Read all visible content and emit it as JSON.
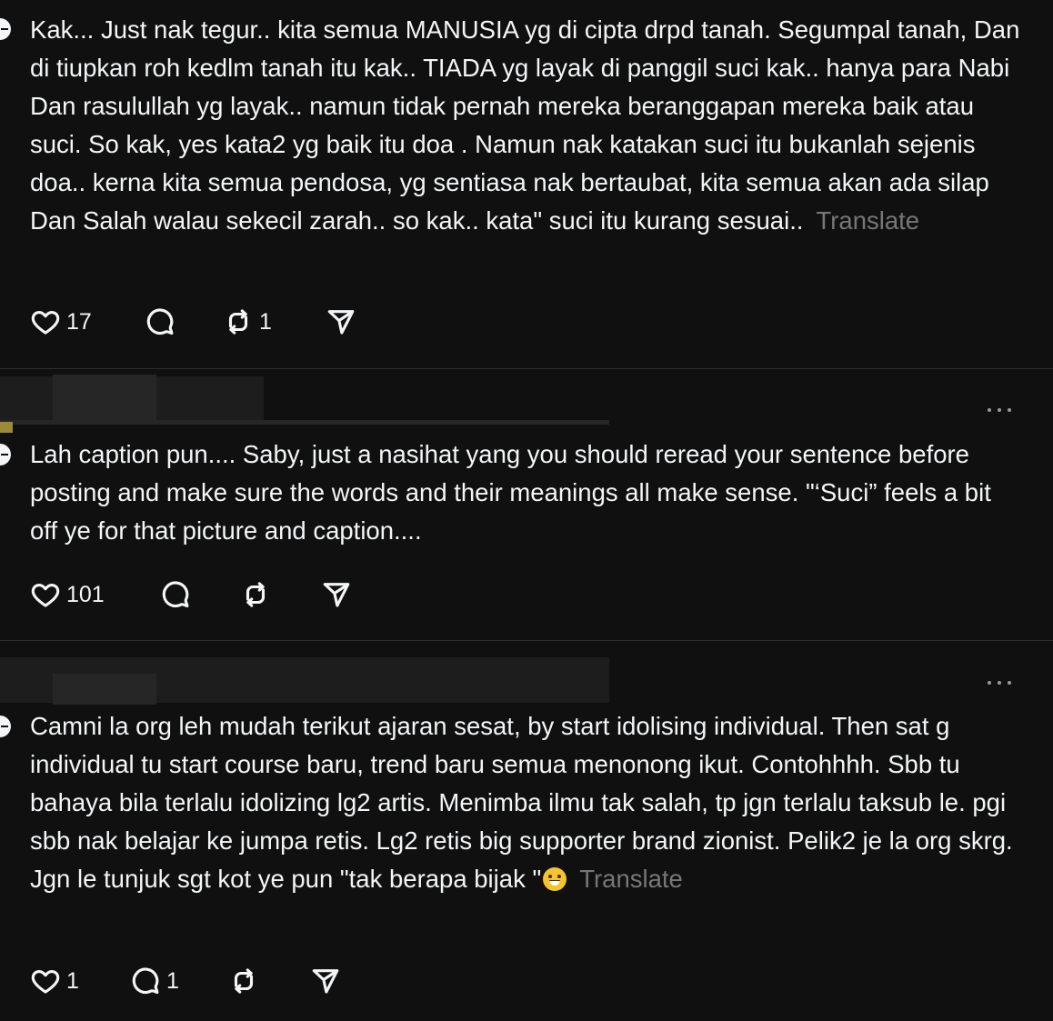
{
  "comments": [
    {
      "text": "Kak... Just nak tegur.. kita semua MANUSIA yg di cipta drpd tanah. Segumpal tanah, Dan di tiupkan roh kedlm tanah itu kak.. TIADA yg layak di panggil suci kak.. hanya para Nabi Dan rasulullah yg layak.. namun tidak pernah mereka beranggapan mereka baik atau suci. So kak, yes kata2 yg baik itu doa . Namun nak katakan suci itu bukanlah sejenis doa.. kerna kita semua pendosa, yg sentiasa nak bertaubat, kita semua akan ada silap Dan Salah walau sekecil zarah.. so kak.. kata\" suci itu kurang sesuai..",
      "translate": "Translate",
      "likes": "17",
      "replies": "",
      "reposts": "1"
    },
    {
      "text": "Lah caption pun.... Saby, just a nasihat yang you should reread your sentence before posting and make sure the words and their meanings all make sense. \"‘Suci” feels a bit off ye for that picture and caption....",
      "translate": "",
      "likes": "101",
      "replies": "",
      "reposts": ""
    },
    {
      "text": "Camni la org leh mudah terikut ajaran sesat, by start idolising individual. Then sat g individual tu start course baru, trend baru semua menonong ikut. Contohhhh. Sbb tu bahaya bila terlalu idolizing lg2 artis. Menimba ilmu tak salah, tp jgn terlalu taksub le. pgi sbb nak belajar ke jumpa retis. Lg2 retis big supporter brand zionist. Pelik2 je la org skrg. Jgn le tunjuk sgt kot ye pun \"tak berapa bijak \"",
      "emoji": "grinning-sweat-emoji",
      "translate": "Translate",
      "likes": "1",
      "replies": "1",
      "reposts": ""
    }
  ],
  "icons": {
    "like": "heart-icon",
    "reply": "comment-icon",
    "repost": "repost-icon",
    "share": "send-icon",
    "more": "more-icon"
  },
  "colors": {
    "background": "#101010",
    "text": "#f3f5f7",
    "muted": "#777777"
  }
}
